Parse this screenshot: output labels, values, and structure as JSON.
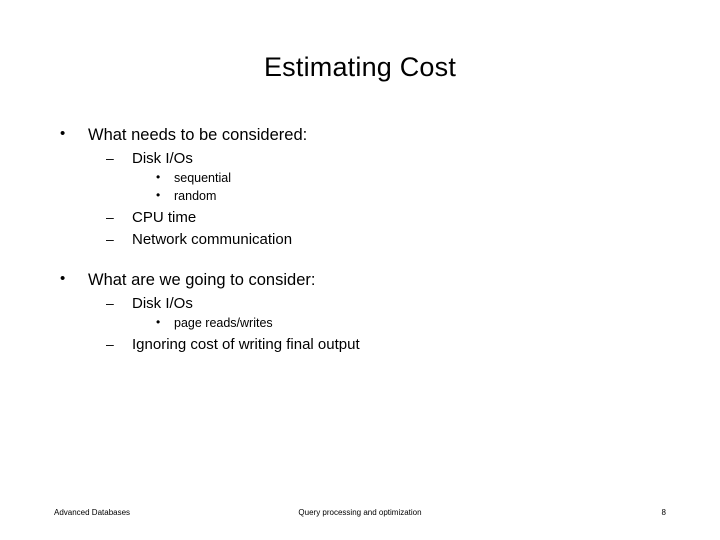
{
  "slide": {
    "title": "Estimating Cost",
    "bullet_markers": {
      "level1": "•",
      "level2": "–",
      "level3": "•"
    },
    "sections": [
      {
        "heading": "What needs to be considered:",
        "items": [
          {
            "level": 2,
            "text": "Disk I/Os"
          },
          {
            "level": 3,
            "text": "sequential"
          },
          {
            "level": 3,
            "text": "random"
          },
          {
            "level": 2,
            "text": "CPU time"
          },
          {
            "level": 2,
            "text": "Network communication"
          }
        ]
      },
      {
        "heading": "What are we going to consider:",
        "items": [
          {
            "level": 2,
            "text": "Disk I/Os"
          },
          {
            "level": 3,
            "text": "page reads/writes"
          },
          {
            "level": 2,
            "text": "Ignoring cost of writing final output"
          }
        ]
      }
    ]
  },
  "footer": {
    "left": "Advanced Databases",
    "center": "Query processing and optimization",
    "right": "8"
  }
}
